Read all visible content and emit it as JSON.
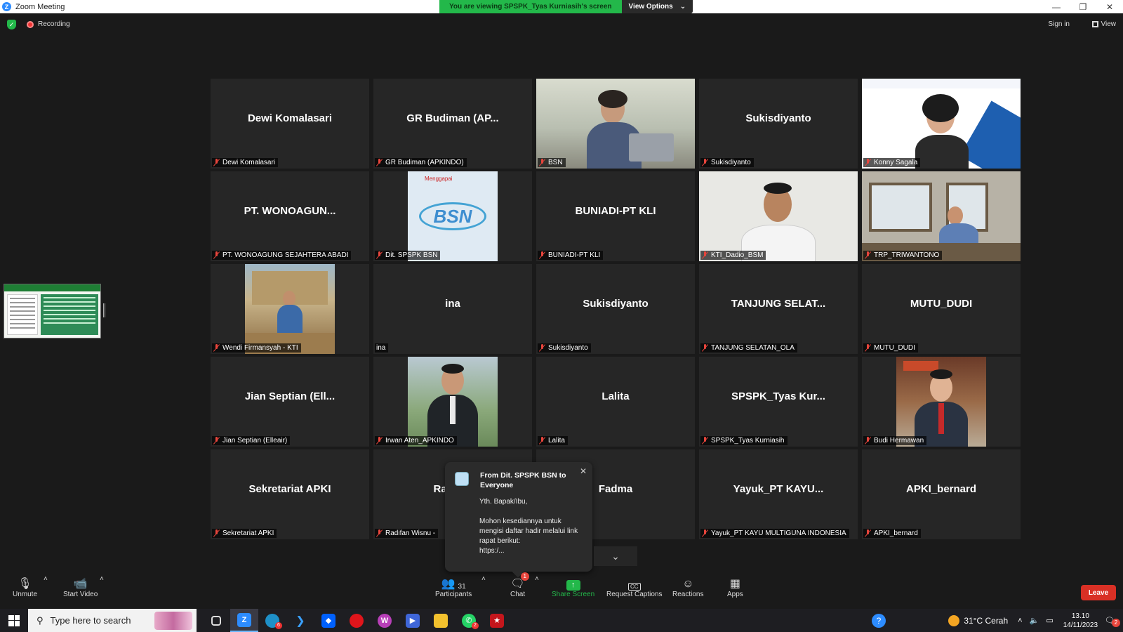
{
  "window": {
    "app_icon": "zoom-icon",
    "title": "Zoom Meeting",
    "controls": [
      "minimize-icon",
      "restore-icon",
      "close-icon"
    ]
  },
  "share_banner": {
    "message": "You are viewing SPSPK_Tyas Kurniasih's screen",
    "options": "View Options",
    "color": "#23b84a"
  },
  "status": {
    "recording": "Recording",
    "sign_in": "Sign in",
    "view": "View"
  },
  "tiles": [
    {
      "name": "Dewi Komalasari",
      "label": "Dewi Komalasari",
      "type": "name"
    },
    {
      "name": "GR Budiman  (AP...",
      "label": "GR Budiman (APKINDO)",
      "type": "name"
    },
    {
      "name": "",
      "label": "BSN",
      "type": "video-office",
      "active": true
    },
    {
      "name": "Sukisdiyanto",
      "label": "Sukisdiyanto",
      "type": "name"
    },
    {
      "name": "",
      "label": "Konny Sagala",
      "type": "video-slide"
    },
    {
      "name": "PT.  WONOAGUN...",
      "label": "PT. WONOAGUNG SEJAHTERA ABADI",
      "type": "name"
    },
    {
      "name": "",
      "label": "Dit. SPSPK BSN",
      "type": "bsn-logo"
    },
    {
      "name": "BUNIADI-PT KLI",
      "label": "BUNIADI-PT KLI",
      "type": "name"
    },
    {
      "name": "",
      "label": "KTI_Dadio_BSM",
      "type": "video-man"
    },
    {
      "name": "",
      "label": "TRP_TRIWANTONO",
      "type": "video-room"
    },
    {
      "name": "",
      "label": "Wendi Firmansyah - KTI",
      "type": "photo-logs"
    },
    {
      "name": "ina",
      "label": "ina",
      "type": "name",
      "unmuted": true
    },
    {
      "name": "Sukisdiyanto",
      "label": "Sukisdiyanto",
      "type": "name"
    },
    {
      "name": "TANJUNG  SELAT...",
      "label": "TANJUNG SELATAN_OLA",
      "type": "name"
    },
    {
      "name": "MUTU_DUDI",
      "label": "MUTU_DUDI",
      "type": "name"
    },
    {
      "name": "Jian  Septian  (Ell...",
      "label": "Jian Septian (Elleair)",
      "type": "name"
    },
    {
      "name": "",
      "label": "Irwan Aten_APKINDO",
      "type": "photo-suit"
    },
    {
      "name": "Lalita",
      "label": "Lalita",
      "type": "name"
    },
    {
      "name": "SPSPK_Tyas  Kur...",
      "label": "SPSPK_Tyas Kurniasih",
      "type": "name"
    },
    {
      "name": "",
      "label": "Budi Hermawan",
      "type": "photo-tie"
    },
    {
      "name": "Sekretariat APKI",
      "label": "Sekretariat APKI",
      "type": "name"
    },
    {
      "name": "Radifan",
      "label": "Radifan Wisnu - ",
      "type": "name"
    },
    {
      "name": "Fadma",
      "label": "",
      "type": "name"
    },
    {
      "name": "Yayuk_PT  KAYU...",
      "label": "Yayuk_PT KAYU MULTIGUNA INDONESIA",
      "type": "name"
    },
    {
      "name": "APKI_bernard",
      "label": "APKI_bernard",
      "type": "name"
    }
  ],
  "chat_popup": {
    "from": "From Dit. SPSPK BSN to Everyone",
    "line1": "Yth. Bapak/Ibu,",
    "line2": "Mohon kesediannya untuk mengisi daftar hadir melalui link rapat berikut:",
    "line3": "https:/..."
  },
  "toolbar": {
    "unmute": "Unmute",
    "start_video": "Start Video",
    "participants": "Participants",
    "participants_count": "31",
    "chat": "Chat",
    "chat_badge": "1",
    "share_screen": "Share Screen",
    "request_captions": "Request Captions",
    "reactions": "Reactions",
    "apps": "Apps",
    "leave": "Leave"
  },
  "taskbar": {
    "search_placeholder": "Type here to search",
    "weather": "31°C  Cerah",
    "time": "13.10",
    "date": "14/11/2023",
    "notification_count": "2",
    "whatsapp_badge": "2",
    "edge_badge": "6"
  }
}
